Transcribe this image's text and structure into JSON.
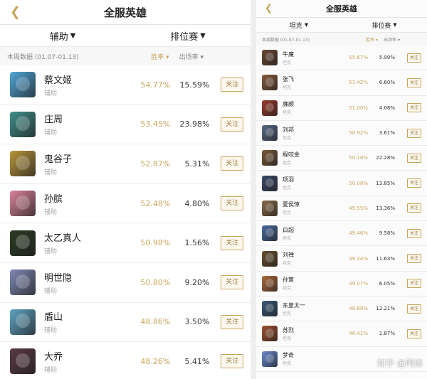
{
  "left": {
    "title": "全服英雄",
    "back_icon": "chevron-left-icon",
    "filters": [
      {
        "label": "辅助"
      },
      {
        "label": "排位赛"
      }
    ],
    "week_label": "本周数据 (01.07-01.13)",
    "sort_winrate": "胜率",
    "sort_pickrate": "出场率",
    "heroes": [
      {
        "name": "蔡文姬",
        "role": "辅助",
        "winrate": "54.77%",
        "pickrate": "15.59%",
        "follow": "关注",
        "color": "#4fa6d9"
      },
      {
        "name": "庄周",
        "role": "辅助",
        "winrate": "53.45%",
        "pickrate": "23.98%",
        "follow": "关注",
        "color": "#3f8f8a"
      },
      {
        "name": "鬼谷子",
        "role": "辅助",
        "winrate": "52.87%",
        "pickrate": "5.31%",
        "follow": "关注",
        "color": "#b9953a"
      },
      {
        "name": "孙膑",
        "role": "辅助",
        "winrate": "52.48%",
        "pickrate": "4.80%",
        "follow": "关注",
        "color": "#d9829a"
      },
      {
        "name": "太乙真人",
        "role": "辅助",
        "winrate": "50.98%",
        "pickrate": "1.56%",
        "follow": "关注",
        "color": "#2a3a22"
      },
      {
        "name": "明世隐",
        "role": "辅助",
        "winrate": "50.80%",
        "pickrate": "9.20%",
        "follow": "关注",
        "color": "#7e88b4"
      },
      {
        "name": "盾山",
        "role": "辅助",
        "winrate": "48.86%",
        "pickrate": "3.50%",
        "follow": "关注",
        "color": "#5fa3c4"
      },
      {
        "name": "大乔",
        "role": "辅助",
        "winrate": "48.26%",
        "pickrate": "5.41%",
        "follow": "关注",
        "color": "#5a3a44"
      }
    ]
  },
  "right": {
    "title": "全服英雄",
    "back_icon": "chevron-left-icon",
    "filters": [
      {
        "label": "坦克"
      },
      {
        "label": "排位赛"
      }
    ],
    "week_label": "本周数据 (01.07-01.13)",
    "sort_winrate": "胜率",
    "sort_pickrate": "出场率",
    "heroes": [
      {
        "name": "牛魔",
        "role": "坦克",
        "winrate": "55.67%",
        "pickrate": "5.99%",
        "follow": "关注",
        "color": "#6b4a34"
      },
      {
        "name": "张飞",
        "role": "坦克",
        "winrate": "51.42%",
        "pickrate": "6.60%",
        "follow": "关注",
        "color": "#8a5a3a"
      },
      {
        "name": "廉颇",
        "role": "坦克",
        "winrate": "51.00%",
        "pickrate": "4.08%",
        "follow": "关注",
        "color": "#9a3b2c"
      },
      {
        "name": "刘邦",
        "role": "坦克",
        "winrate": "50.92%",
        "pickrate": "3.61%",
        "follow": "关注",
        "color": "#5a6a8a"
      },
      {
        "name": "程咬金",
        "role": "坦克",
        "winrate": "50.18%",
        "pickrate": "22.28%",
        "follow": "关注",
        "color": "#7a5a3a"
      },
      {
        "name": "项羽",
        "role": "坦克",
        "winrate": "50.08%",
        "pickrate": "13.85%",
        "follow": "关注",
        "color": "#3a4a6a"
      },
      {
        "name": "夏侯惇",
        "role": "坦克",
        "winrate": "49.55%",
        "pickrate": "13.36%",
        "follow": "关注",
        "color": "#8a6a4a"
      },
      {
        "name": "白起",
        "role": "坦克",
        "winrate": "49.46%",
        "pickrate": "9.58%",
        "follow": "关注",
        "color": "#4a6aa0"
      },
      {
        "name": "刘禅",
        "role": "坦克",
        "winrate": "49.24%",
        "pickrate": "11.63%",
        "follow": "关注",
        "color": "#6a5030"
      },
      {
        "name": "孙策",
        "role": "坦克",
        "winrate": "49.07%",
        "pickrate": "6.05%",
        "follow": "关注",
        "color": "#b06a3a"
      },
      {
        "name": "东皇太一",
        "role": "坦克",
        "winrate": "48.88%",
        "pickrate": "12.21%",
        "follow": "关注",
        "color": "#3a5a7a"
      },
      {
        "name": "苏烈",
        "role": "坦克",
        "winrate": "46.41%",
        "pickrate": "1.87%",
        "follow": "关注",
        "color": "#a05030"
      },
      {
        "name": "梦奇",
        "role": "坦克",
        "winrate": "",
        "pickrate": "",
        "follow": "",
        "color": "#6a8ad0"
      }
    ]
  },
  "watermark": "知乎 @阿修"
}
